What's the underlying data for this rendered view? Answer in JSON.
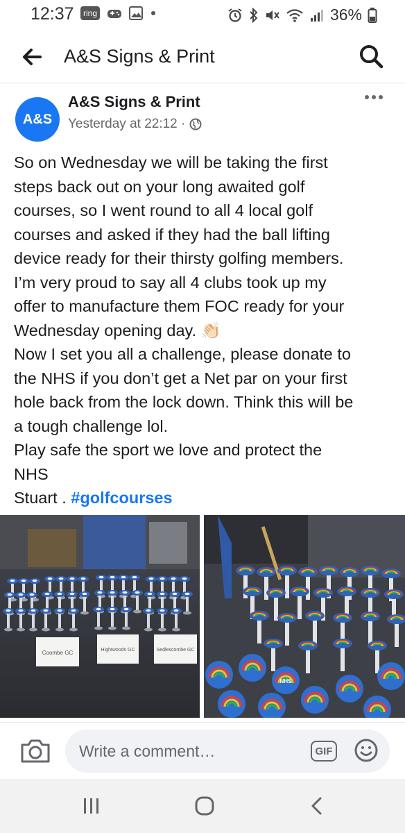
{
  "status_bar": {
    "time": "12:37",
    "left_icons": [
      "ring-icon",
      "game-controller-icon",
      "image-icon",
      "dot-icon"
    ],
    "ring_label": "ring",
    "right_icons": [
      "alarm-icon",
      "bluetooth-icon",
      "mute-icon",
      "wifi-icon",
      "signal-icon",
      "battery-icon"
    ],
    "battery": "36%"
  },
  "app_bar": {
    "title": "A&S Signs & Print",
    "back_icon": "back-arrow-icon",
    "search_icon": "search-icon"
  },
  "post": {
    "avatar_text": "A&S",
    "page_name": "A&S Signs & Print",
    "timestamp": "Yesterday at 22:12 ·",
    "privacy_icon": "globe-icon",
    "more_icon": "more-options-icon",
    "text_lines": [
      "So on Wednesday we will be taking the first",
      "steps back out on your long awaited golf",
      "courses, so I went round to all 4 local golf",
      "courses and asked if they had the ball lifting",
      "device ready for their thirsty golfing members.",
      "I’m very proud to say all 4 clubs took up my",
      "offer to manufacture them FOC ready for your",
      "Wednesday opening day. 👏🏻",
      "Now I set you all a challenge, please donate to",
      "the NHS if you don’t get a Net par on your first",
      "hole back from the lock down. Think this will be",
      "a tough challenge lol.",
      "Play safe the sport we love and protect the",
      "NHS"
    ],
    "signature": "Stuart . ",
    "hashtag": "#golfcourses",
    "photos": {
      "left_signs": [
        "Coombe GC",
        "Hightwoods GC",
        "Sedlescombe GC"
      ],
      "right_label": "NHS"
    }
  },
  "comment_bar": {
    "placeholder": "Write a comment…",
    "gif_label": "GIF",
    "camera_icon": "camera-icon",
    "emoji_icon": "emoji-icon"
  },
  "nav_bar": {
    "icons": [
      "recent-apps-icon",
      "home-icon",
      "back-icon"
    ]
  }
}
